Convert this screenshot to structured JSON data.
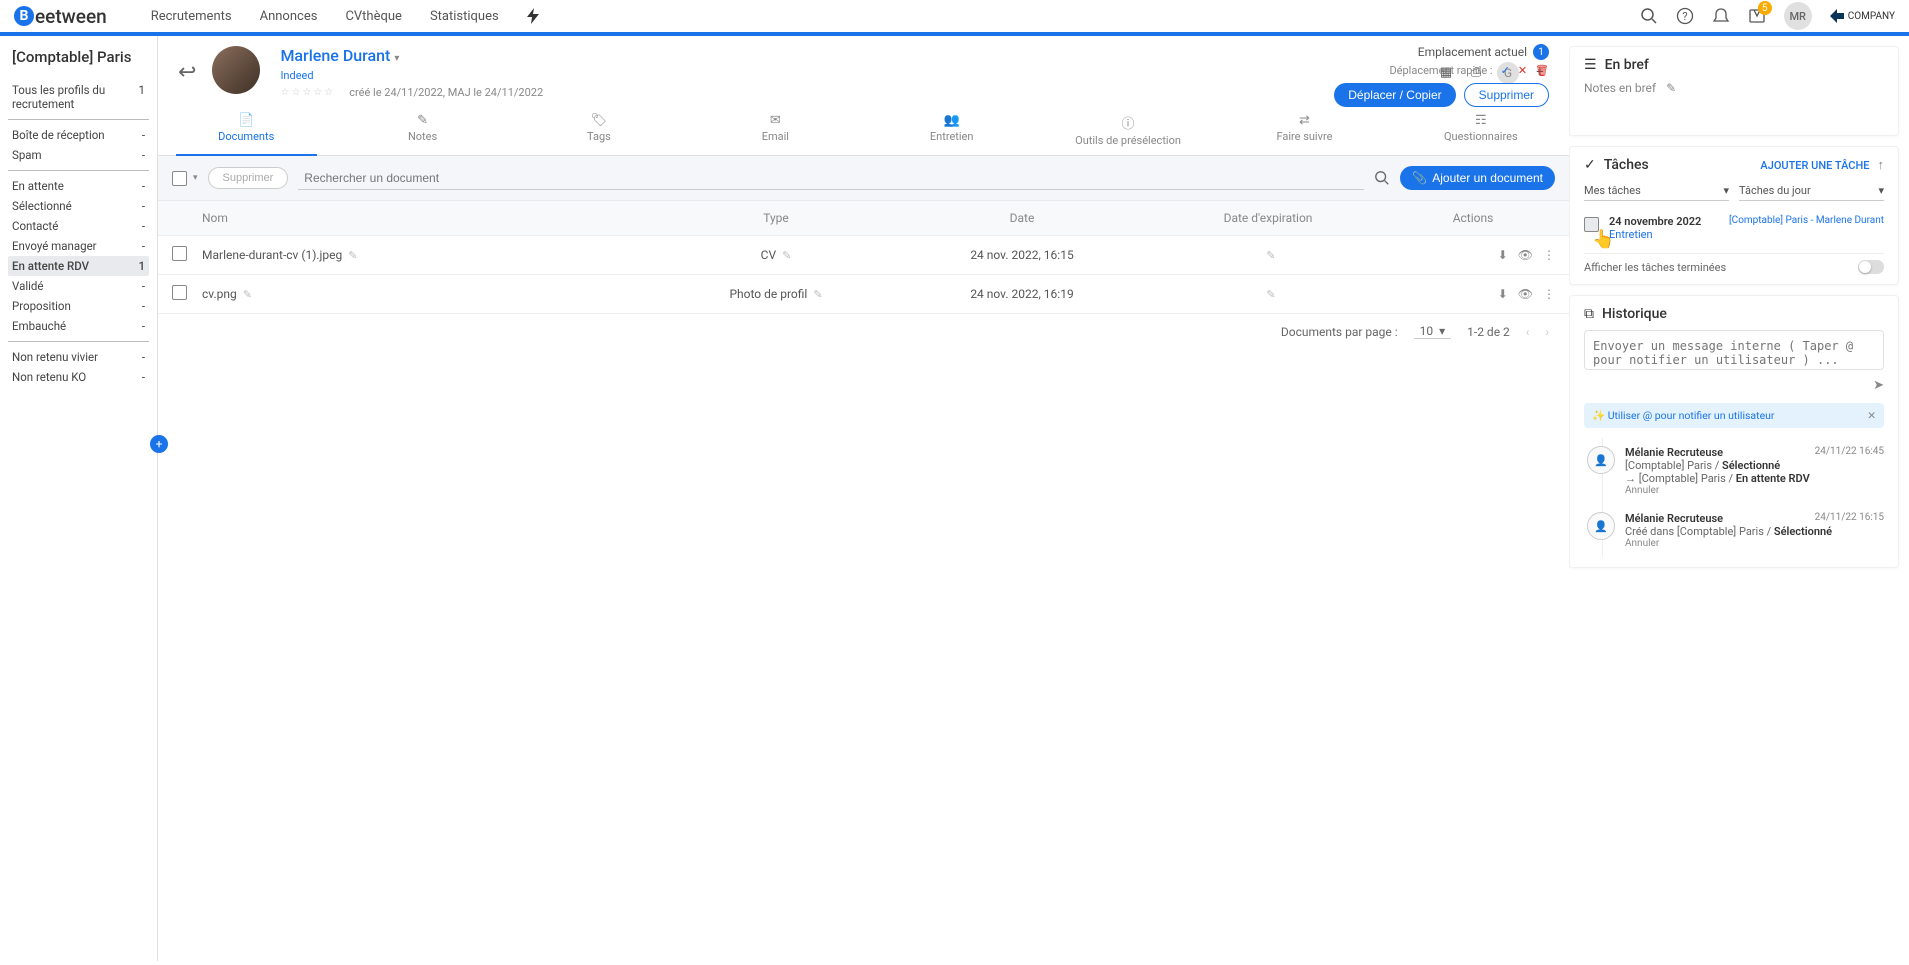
{
  "brand": "eetween",
  "nav": {
    "recrutements": "Recrutements",
    "annonces": "Annonces",
    "cvtheque": "CVthèque",
    "statistiques": "Statistiques"
  },
  "notif_count": "5",
  "user_initials": "MR",
  "company": "COMPANY",
  "sidebar": {
    "title": "[Comptable] Paris",
    "all_profiles": {
      "label": "Tous les profils du recrutement",
      "count": "1"
    },
    "groups": [
      [
        {
          "label": "Boîte de réception",
          "count": "-"
        },
        {
          "label": "Spam",
          "count": "-"
        }
      ],
      [
        {
          "label": "En attente",
          "count": "-"
        },
        {
          "label": "Sélectionné",
          "count": "-"
        },
        {
          "label": "Contacté",
          "count": "-"
        },
        {
          "label": "Envoyé manager",
          "count": "-"
        },
        {
          "label": "En attente RDV",
          "count": "1",
          "active": true
        },
        {
          "label": "Validé",
          "count": "-"
        },
        {
          "label": "Proposition",
          "count": "-"
        },
        {
          "label": "Embauché",
          "count": "-"
        }
      ],
      [
        {
          "label": "Non retenu vivier",
          "count": "-"
        },
        {
          "label": "Non retenu KO",
          "count": "-"
        }
      ]
    ]
  },
  "profile": {
    "name": "Marlene Durant",
    "source": "Indeed",
    "meta": "créé le 24/11/2022, MAJ le 24/11/2022",
    "loc_label": "Emplacement actuel",
    "loc_count": "1",
    "quick_label": "Déplacement rapide :",
    "move_btn": "Déplacer / Copier",
    "delete_btn": "Supprimer"
  },
  "tabs": {
    "documents": "Documents",
    "notes": "Notes",
    "tags": "Tags",
    "email": "Email",
    "entretien": "Entretien",
    "outils": "Outils de présélection",
    "faire_suivre": "Faire suivre",
    "questionnaires": "Questionnaires"
  },
  "docs": {
    "supprimer": "Supprimer",
    "search_placeholder": "Rechercher un document",
    "add_btn": "Ajouter un document",
    "cols": {
      "nom": "Nom",
      "type": "Type",
      "date": "Date",
      "exp": "Date d'expiration",
      "actions": "Actions"
    },
    "rows": [
      {
        "name": "Marlene-durant-cv (1).jpeg",
        "type": "CV",
        "date": "24 nov. 2022, 16:15"
      },
      {
        "name": "cv.png",
        "type": "Photo de profil",
        "date": "24 nov. 2022, 16:19"
      }
    ],
    "per_page_label": "Documents par page :",
    "per_page_value": "10",
    "range": "1-2 de 2"
  },
  "enbref": {
    "title": "En bref",
    "notes": "Notes en bref"
  },
  "tasks": {
    "title": "Tâches",
    "add": "AJOUTER UNE TÂCHE",
    "drop1": "Mes tâches",
    "drop2": "Tâches du jour",
    "task_date": "24 novembre 2022",
    "task_type": "Entretien",
    "task_link_job": "[Comptable] Paris",
    "task_link_person": "Marlene Durant",
    "show_done": "Afficher les tâches terminées"
  },
  "history": {
    "title": "Historique",
    "msg_placeholder": "Envoyer un message interne ( Taper @ pour notifier un utilisateur ) ...",
    "tip": "Utiliser @ pour notifier un utilisateur",
    "entries": [
      {
        "author": "Mélanie Recruteuse",
        "time": "24/11/22 16:45",
        "from_job": "[Comptable] Paris /",
        "from_stage": "Sélectionné",
        "arrow": "→",
        "to_job": "[Comptable] Paris /",
        "to_stage": "En attente RDV",
        "cancel": "Annuler"
      },
      {
        "author": "Mélanie Recruteuse",
        "time": "24/11/22 16:15",
        "created_prefix": "Créé dans",
        "created_job": "[Comptable] Paris /",
        "created_stage": "Sélectionné",
        "cancel": "Annuler"
      }
    ]
  }
}
